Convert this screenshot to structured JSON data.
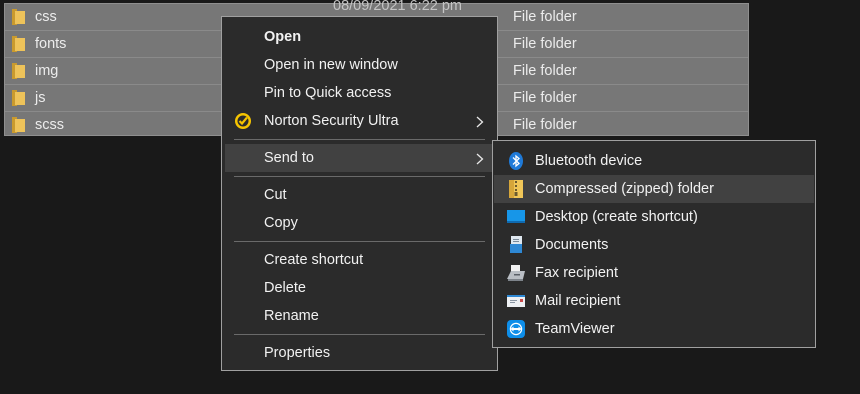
{
  "files": [
    {
      "name": "css",
      "date": "08/09/2021 6:22 pm",
      "type": "File folder"
    },
    {
      "name": "fonts",
      "date": "",
      "type": "File folder"
    },
    {
      "name": "img",
      "date": "",
      "type": "File folder"
    },
    {
      "name": "js",
      "date": "",
      "type": "File folder"
    },
    {
      "name": "scss",
      "date": "",
      "type": "File folder"
    }
  ],
  "context_menu": {
    "open": "Open",
    "open_new_window": "Open in new window",
    "pin_quick_access": "Pin to Quick access",
    "norton": "Norton Security Ultra",
    "send_to": "Send to",
    "cut": "Cut",
    "copy": "Copy",
    "create_shortcut": "Create shortcut",
    "delete": "Delete",
    "rename": "Rename",
    "properties": "Properties"
  },
  "send_to_menu": {
    "items": [
      {
        "label": "Bluetooth device",
        "icon": "bluetooth-icon"
      },
      {
        "label": "Compressed (zipped) folder",
        "icon": "zip-folder-icon"
      },
      {
        "label": "Desktop (create shortcut)",
        "icon": "desktop-icon"
      },
      {
        "label": "Documents",
        "icon": "documents-icon"
      },
      {
        "label": "Fax recipient",
        "icon": "fax-icon"
      },
      {
        "label": "Mail recipient",
        "icon": "mail-icon"
      },
      {
        "label": "TeamViewer",
        "icon": "teamviewer-icon"
      }
    ]
  },
  "colors": {
    "background": "#191919",
    "selection": "#777777",
    "menu_bg": "#2b2b2b",
    "menu_highlight": "#414141",
    "folder": "#e8b84a",
    "accent_blue": "#0a74da"
  }
}
